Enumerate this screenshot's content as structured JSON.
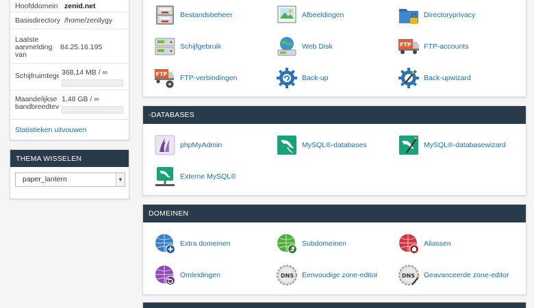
{
  "stats": {
    "domain_label": "Hoofddomein",
    "domain_value": "zenid.net",
    "homedir_label": "Basisdirectory",
    "homedir_value": "/home/zenilygy",
    "lastlogin_label": "Laatste aanmelding van",
    "lastlogin_value": "84.25.16.195",
    "disk_label": "Schijfruimtegebruik",
    "disk_value": "368,14 MB / ∞",
    "bandwidth_label": "Maandelijkse bandbreedteverbruik",
    "bandwidth_value": "1,48 GB / ∞",
    "expand_link": "Statistieken uitvouwen"
  },
  "theme": {
    "title": "THEMA WISSELEN",
    "selected": "paper_lantern"
  },
  "files": {
    "items": [
      {
        "label": "Bestandsbeheer"
      },
      {
        "label": "Afbeeldingen"
      },
      {
        "label": "Directoryprivacy"
      },
      {
        "label": "Schijfgebruik"
      },
      {
        "label": "Web Disk"
      },
      {
        "label": "FTP-accounts"
      },
      {
        "label": "FTP-verbindingen"
      },
      {
        "label": "Back-up"
      },
      {
        "label": "Back-upwizard"
      }
    ]
  },
  "databases": {
    "title": "-DATABASES",
    "items": [
      {
        "label": "phpMyAdmin"
      },
      {
        "label": "MySQL®-databases"
      },
      {
        "label": "MySQL®-databasewizard"
      },
      {
        "label": "Externe MySQL®"
      }
    ]
  },
  "domains": {
    "title": "DOMEINEN",
    "items": [
      {
        "label": "Extra domeinen"
      },
      {
        "label": "Subdomeinen"
      },
      {
        "label": "Aliassen"
      },
      {
        "label": "Omleidingen"
      },
      {
        "label": "Eenvoudige zone-editor"
      },
      {
        "label": "Geavanceerde zone-editor"
      }
    ]
  },
  "colors": {
    "header_bg": "#293a4a",
    "link": "#1d6fb8"
  }
}
